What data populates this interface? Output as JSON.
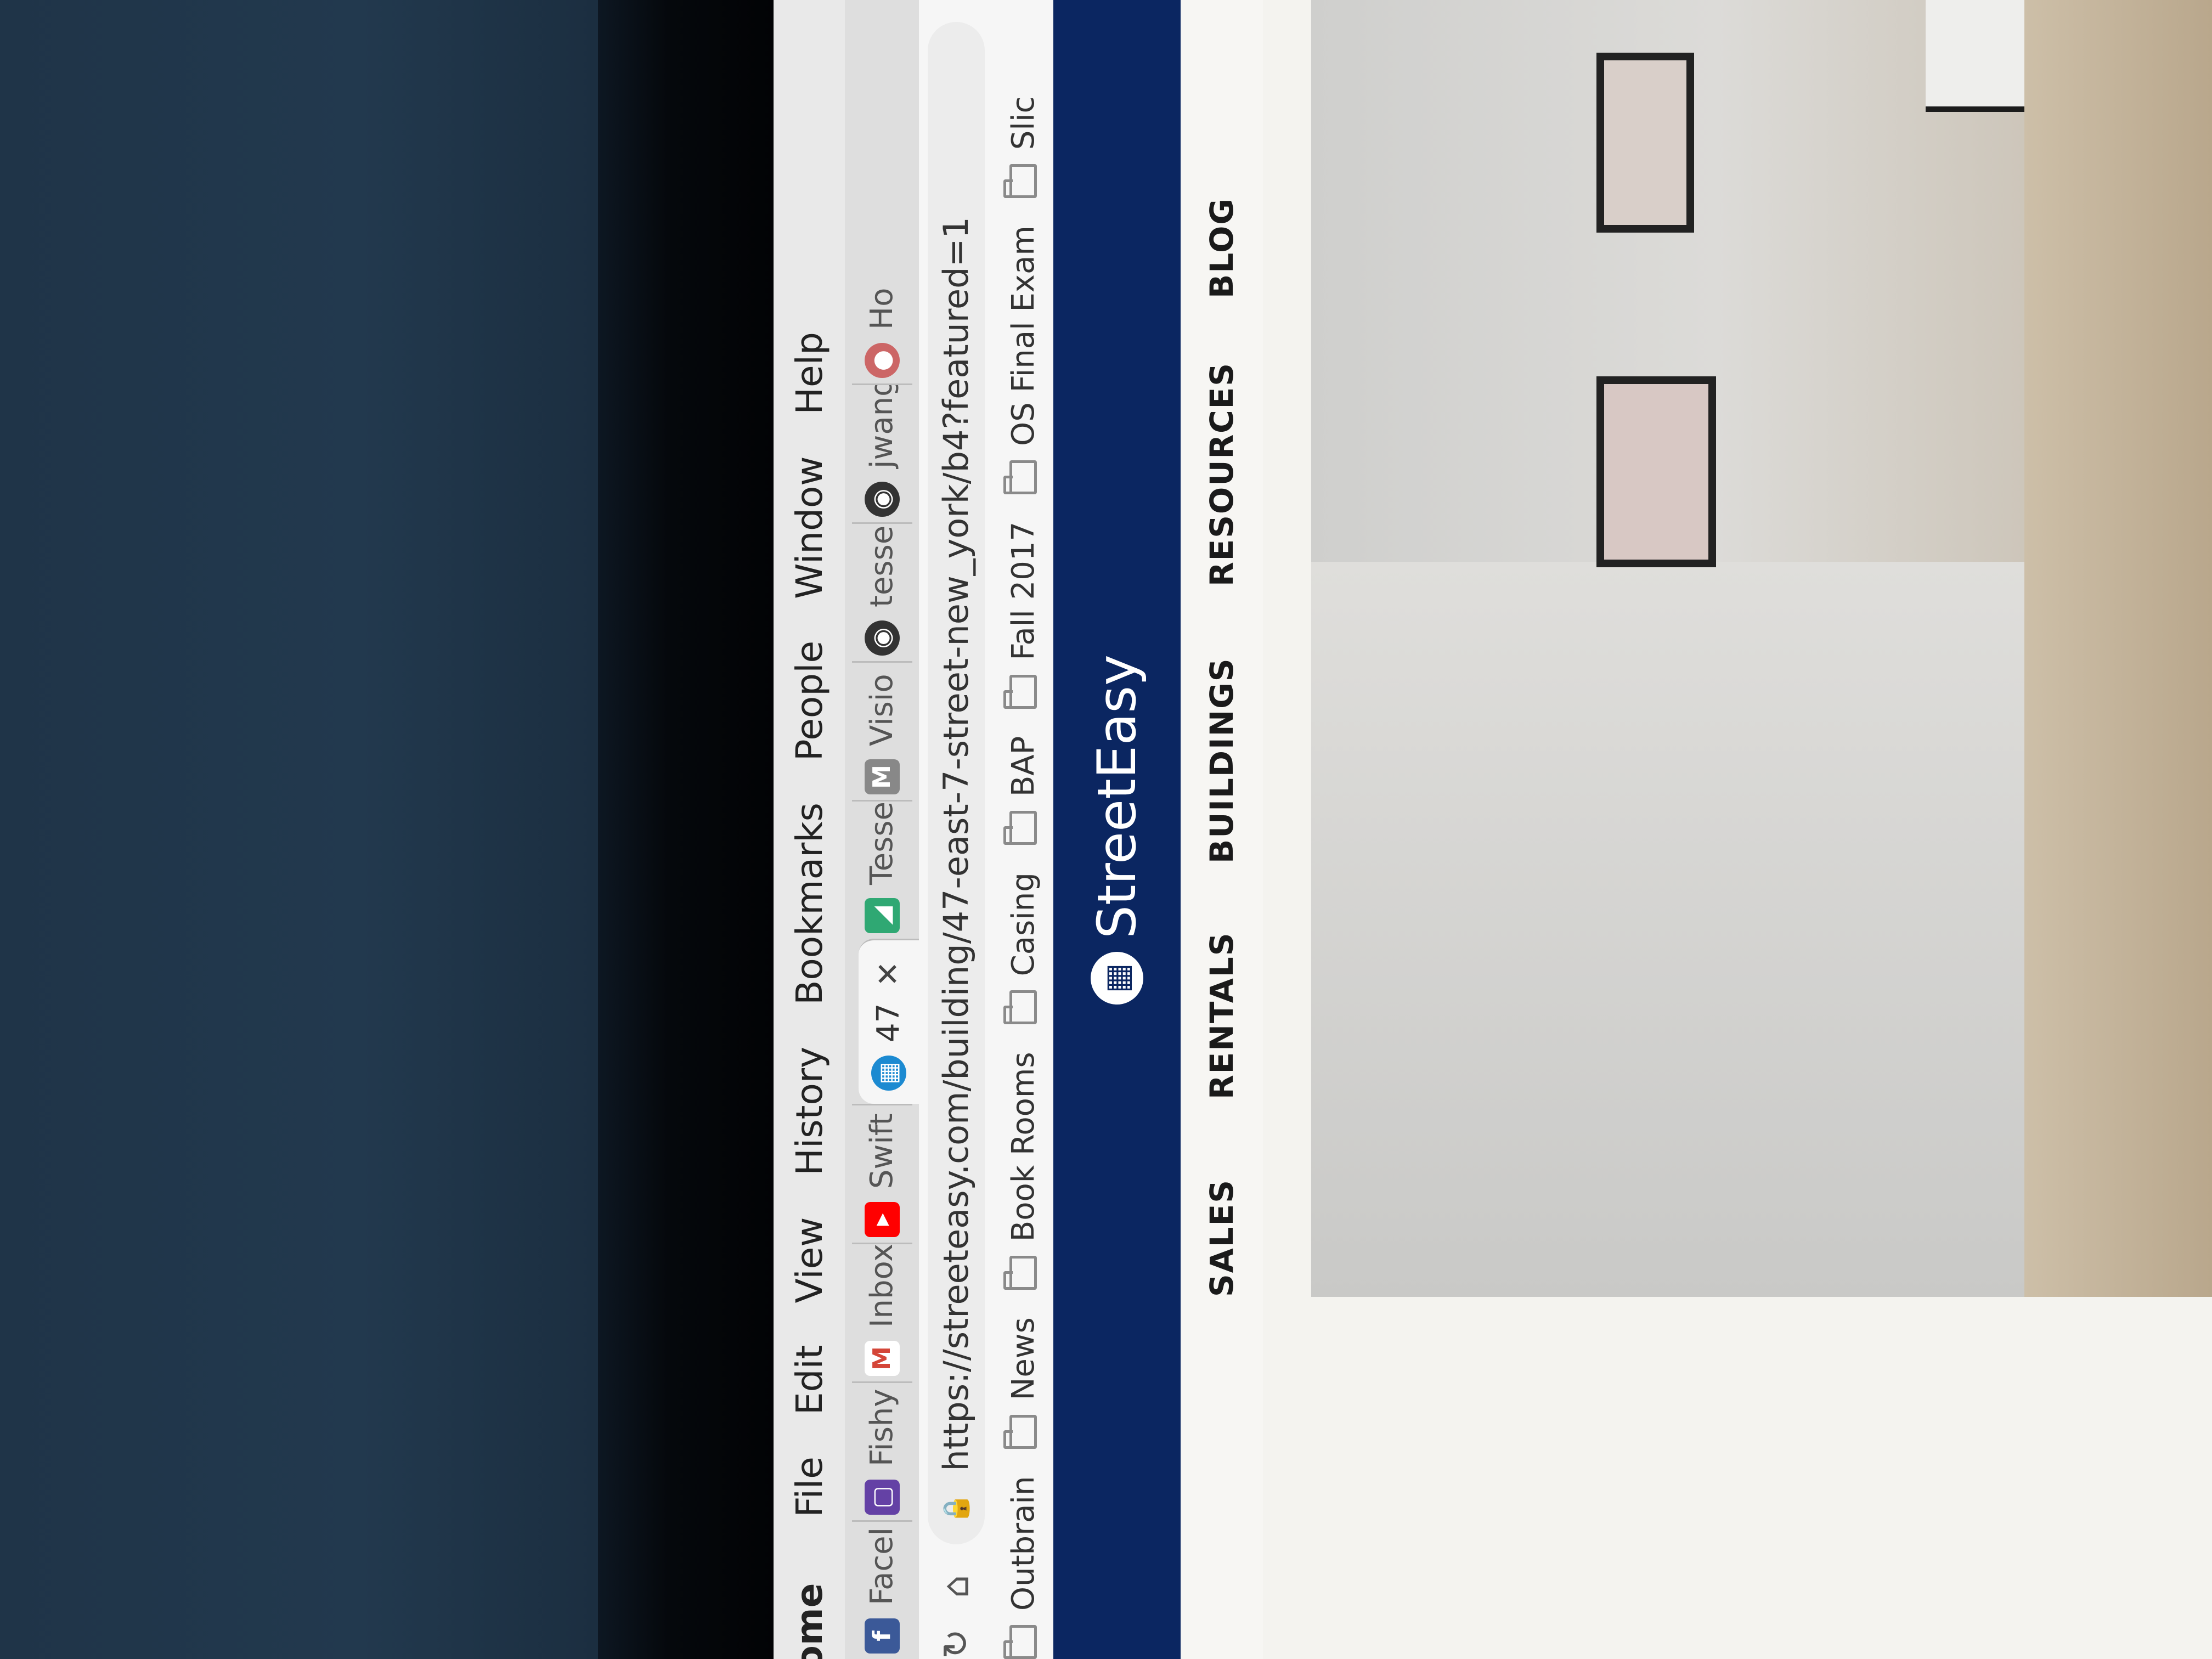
{
  "menu_bar": {
    "app_name": "hrome",
    "items": [
      "File",
      "Edit",
      "View",
      "History",
      "Bookmarks",
      "People",
      "Window",
      "Help"
    ]
  },
  "tabs": [
    {
      "label": "Facel",
      "icon": "facebook-icon",
      "color": "#3b5998",
      "glyph": "f"
    },
    {
      "label": "Fishy",
      "icon": "twitch-icon",
      "color": "#6441a5",
      "glyph": "▢"
    },
    {
      "label": "Inbox",
      "icon": "gmail-icon",
      "color": "#d44638",
      "glyph": "M"
    },
    {
      "label": "Swift",
      "icon": "youtube-icon",
      "color": "#ff0000",
      "glyph": "▶"
    },
    {
      "label": "47",
      "icon": "streeteasy-icon",
      "color": "#1c8ad1",
      "glyph": "▦",
      "active": true
    },
    {
      "label": "Tesse",
      "icon": "doc-icon",
      "color": "#2fa873",
      "glyph": "◢"
    },
    {
      "label": "Visio",
      "icon": "m-icon",
      "color": "#888888",
      "glyph": "M"
    },
    {
      "label": "tesse",
      "icon": "github-icon",
      "color": "#333333",
      "glyph": "◉"
    },
    {
      "label": "jwang",
      "icon": "github-icon",
      "color": "#333333",
      "glyph": "◉"
    },
    {
      "label": "Ho",
      "icon": "app-icon",
      "color": "#cc6666",
      "glyph": "●"
    }
  ],
  "tab_close": "✕",
  "toolbar": {
    "url": "https://streeteasy.com/building/47-east-7-street-new_york/b4?featured=1"
  },
  "bookmarks": [
    "Outbrain",
    "News",
    "Book Rooms",
    "Casing",
    "BAP",
    "Fall 2017",
    "OS Final Exam",
    "Slic"
  ],
  "site": {
    "logo_text": "StreetEasy",
    "nav": [
      "SALES",
      "RENTALS",
      "BUILDINGS",
      "RESOURCES",
      "BLOG"
    ]
  }
}
